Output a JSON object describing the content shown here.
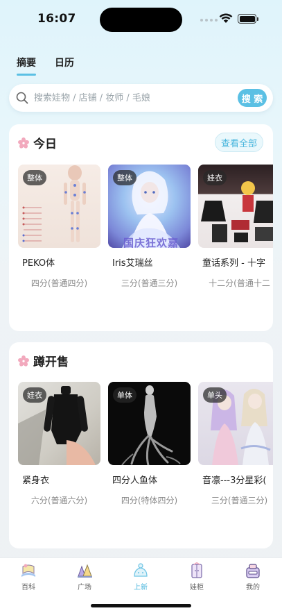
{
  "status": {
    "time": "16:07"
  },
  "tabs": [
    {
      "label": "摘要",
      "active": true
    },
    {
      "label": "日历",
      "active": false
    }
  ],
  "search": {
    "placeholder": "搜索娃物 / 店铺 / 妆师 / 毛娘",
    "button_label": "搜 索"
  },
  "today": {
    "title": "今日",
    "see_all": "查看全部",
    "items": [
      {
        "badge": "整体",
        "name": "PEKO体",
        "sub": "四分(普通四分)"
      },
      {
        "badge": "整体",
        "name": "Iris艾瑞丝",
        "sub": "三分(普通三分)",
        "overlay_text": "国庆狂欢嘉"
      },
      {
        "badge": "娃衣",
        "name": "童话系列 - 十字",
        "sub": "十二分(普通十二"
      }
    ]
  },
  "sale": {
    "title": "蹲开售",
    "items": [
      {
        "badge": "娃衣",
        "name": "紧身衣",
        "sub": "六分(普通六分)"
      },
      {
        "badge": "单体",
        "name": "四分人鱼体",
        "sub": "四分(特体四分)"
      },
      {
        "badge": "单头",
        "name": "音凛---3分星彩(",
        "sub": "三分(普通三分)"
      }
    ]
  },
  "tabbar": [
    {
      "label": "百科",
      "icon": "encyclopedia-icon",
      "active": false
    },
    {
      "label": "广场",
      "icon": "plaza-icon",
      "active": false
    },
    {
      "label": "上新",
      "icon": "new-arrivals-icon",
      "active": true
    },
    {
      "label": "娃柜",
      "icon": "doll-cabinet-icon",
      "active": false
    },
    {
      "label": "我的",
      "icon": "profile-icon",
      "active": false
    }
  ],
  "colors": {
    "accent": "#5bc0e4",
    "petal": "#f2a9bd"
  }
}
